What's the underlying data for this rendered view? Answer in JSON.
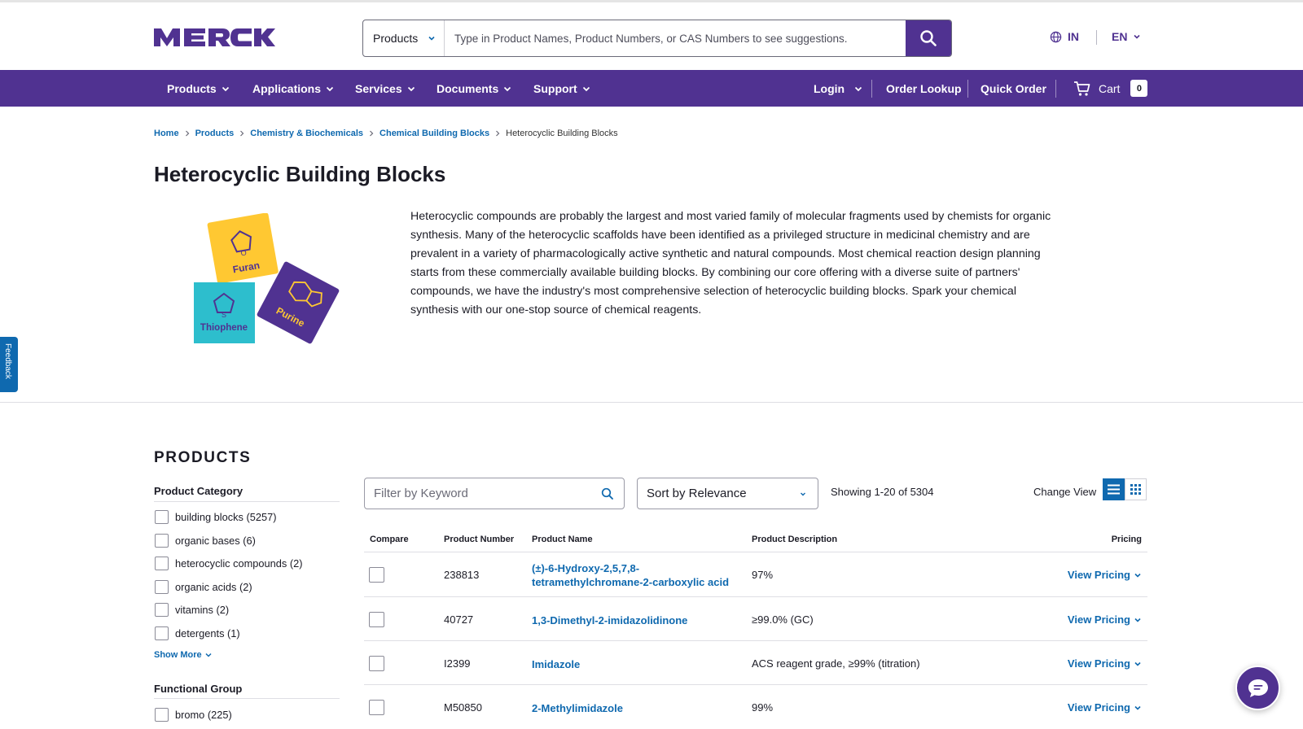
{
  "header": {
    "logo_text": "MERCK",
    "search": {
      "category": "Products",
      "placeholder": "Type in Product Names, Product Numbers, or CAS Numbers to see suggestions."
    },
    "region": "IN",
    "language": "EN"
  },
  "nav": {
    "items": [
      "Products",
      "Applications",
      "Services",
      "Documents",
      "Support"
    ],
    "login": "Login",
    "order_lookup": "Order Lookup",
    "quick_order": "Quick Order",
    "cart": "Cart",
    "cart_count": "0"
  },
  "breadcrumb": {
    "links": [
      "Home",
      "Products",
      "Chemistry & Biochemicals",
      "Chemical Building Blocks"
    ],
    "current": "Heterocyclic Building Blocks"
  },
  "page": {
    "title": "Heterocyclic Building Blocks",
    "description": "Heterocyclic compounds are probably the largest and most varied family of molecular fragments used by chemists for organic synthesis. Many of the heterocyclic scaffolds have been identified as a privileged structure in medicinal chemistry and are prevalent in a variety of pharmacologically active synthetic and natural compounds. Most chemical reaction design planning starts from these commercially available building blocks. By combining our core offering with a diverse suite of partners' compounds, we have the industry's most comprehensive selection of heterocyclic building blocks. Spark your chemical synthesis with our one-stop source of chemical reagents.",
    "image_labels": {
      "furan": "Furan",
      "thiophene": "Thiophene",
      "purine": "Purine"
    },
    "feedback": "Feedback"
  },
  "products": {
    "heading": "PRODUCTS",
    "facets": {
      "category_title": "Product Category",
      "category_items": [
        "building blocks (5257)",
        "organic bases (6)",
        "heterocyclic compounds (2)",
        "organic acids (2)",
        "vitamins (2)",
        "detergents (1)"
      ],
      "show_more": "Show More",
      "functional_title": "Functional Group",
      "functional_items": [
        "bromo (225)"
      ]
    },
    "filter_placeholder": "Filter by Keyword",
    "sort": "Sort by Relevance",
    "showing": "Showing 1-20 of 5304",
    "change_view": "Change View",
    "columns": {
      "compare": "Compare",
      "number": "Product Number",
      "name": "Product Name",
      "description": "Product Description",
      "pricing": "Pricing"
    },
    "rows": [
      {
        "number": "238813",
        "name_line1": "(±)-6-Hydroxy-2,5,7,8-",
        "name_line2": "tetramethylchromane-2-carboxylic acid",
        "description": "97%",
        "pricing": "View Pricing"
      },
      {
        "number": "40727",
        "name_line1": "1,3-Dimethyl-2-imidazolidinone",
        "name_line2": "",
        "description": "≥99.0% (GC)",
        "pricing": "View Pricing"
      },
      {
        "number": "I2399",
        "name_line1": "Imidazole",
        "name_line2": "",
        "description": "ACS reagent grade, ≥99% (titration)",
        "pricing": "View Pricing"
      },
      {
        "number": "M50850",
        "name_line1": "2-Methylimidazole",
        "name_line2": "",
        "description": "99%",
        "pricing": "View Pricing"
      }
    ]
  },
  "colors": {
    "brand_purple": "#503291",
    "link_blue": "#0f69af",
    "furan_yellow": "#ffc832",
    "thiophene_cyan": "#2dbecd"
  }
}
